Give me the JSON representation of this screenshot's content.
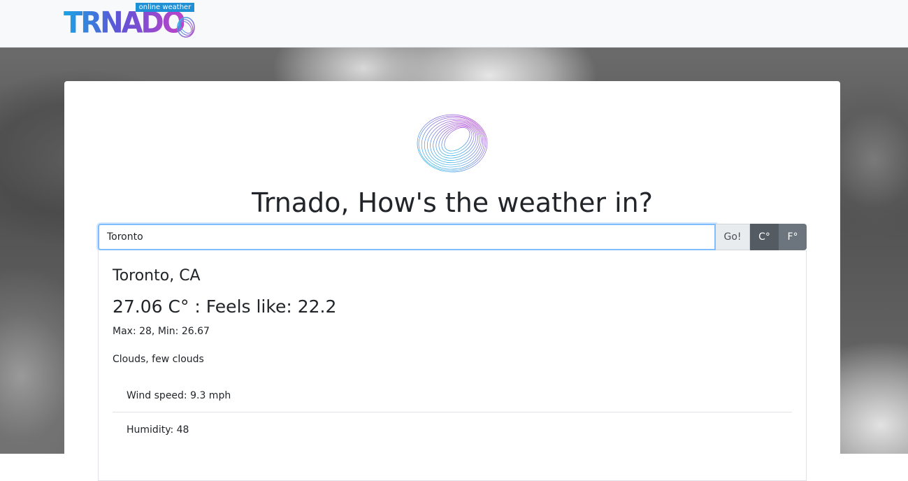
{
  "navbar": {
    "brand_text": "TRNADO",
    "brand_tagline": "online weather"
  },
  "main": {
    "headline": "Trnado, How's the weather in?",
    "search": {
      "value": "Toronto",
      "placeholder": ""
    },
    "go_label": "Go!",
    "unit_celsius": "C°",
    "unit_fahrenheit": "F°"
  },
  "result": {
    "city": "Toronto, CA",
    "temperature_line": "27.06 C° : Feels like: 22.2",
    "max_min": "Max: 28, Min: 26.67",
    "description": "Clouds, few clouds",
    "details": [
      {
        "label": "Wind speed: 9.3 mph"
      },
      {
        "label": "Humidity: 48"
      }
    ]
  },
  "colors": {
    "brand_blue": "#1aa4e4",
    "brand_purple": "#c042c9",
    "focus_border": "#80bdff",
    "unit_active": "#545b62",
    "unit_inactive": "#6c757d"
  },
  "icons": {
    "hero": "swirl-ring-logo-icon"
  }
}
